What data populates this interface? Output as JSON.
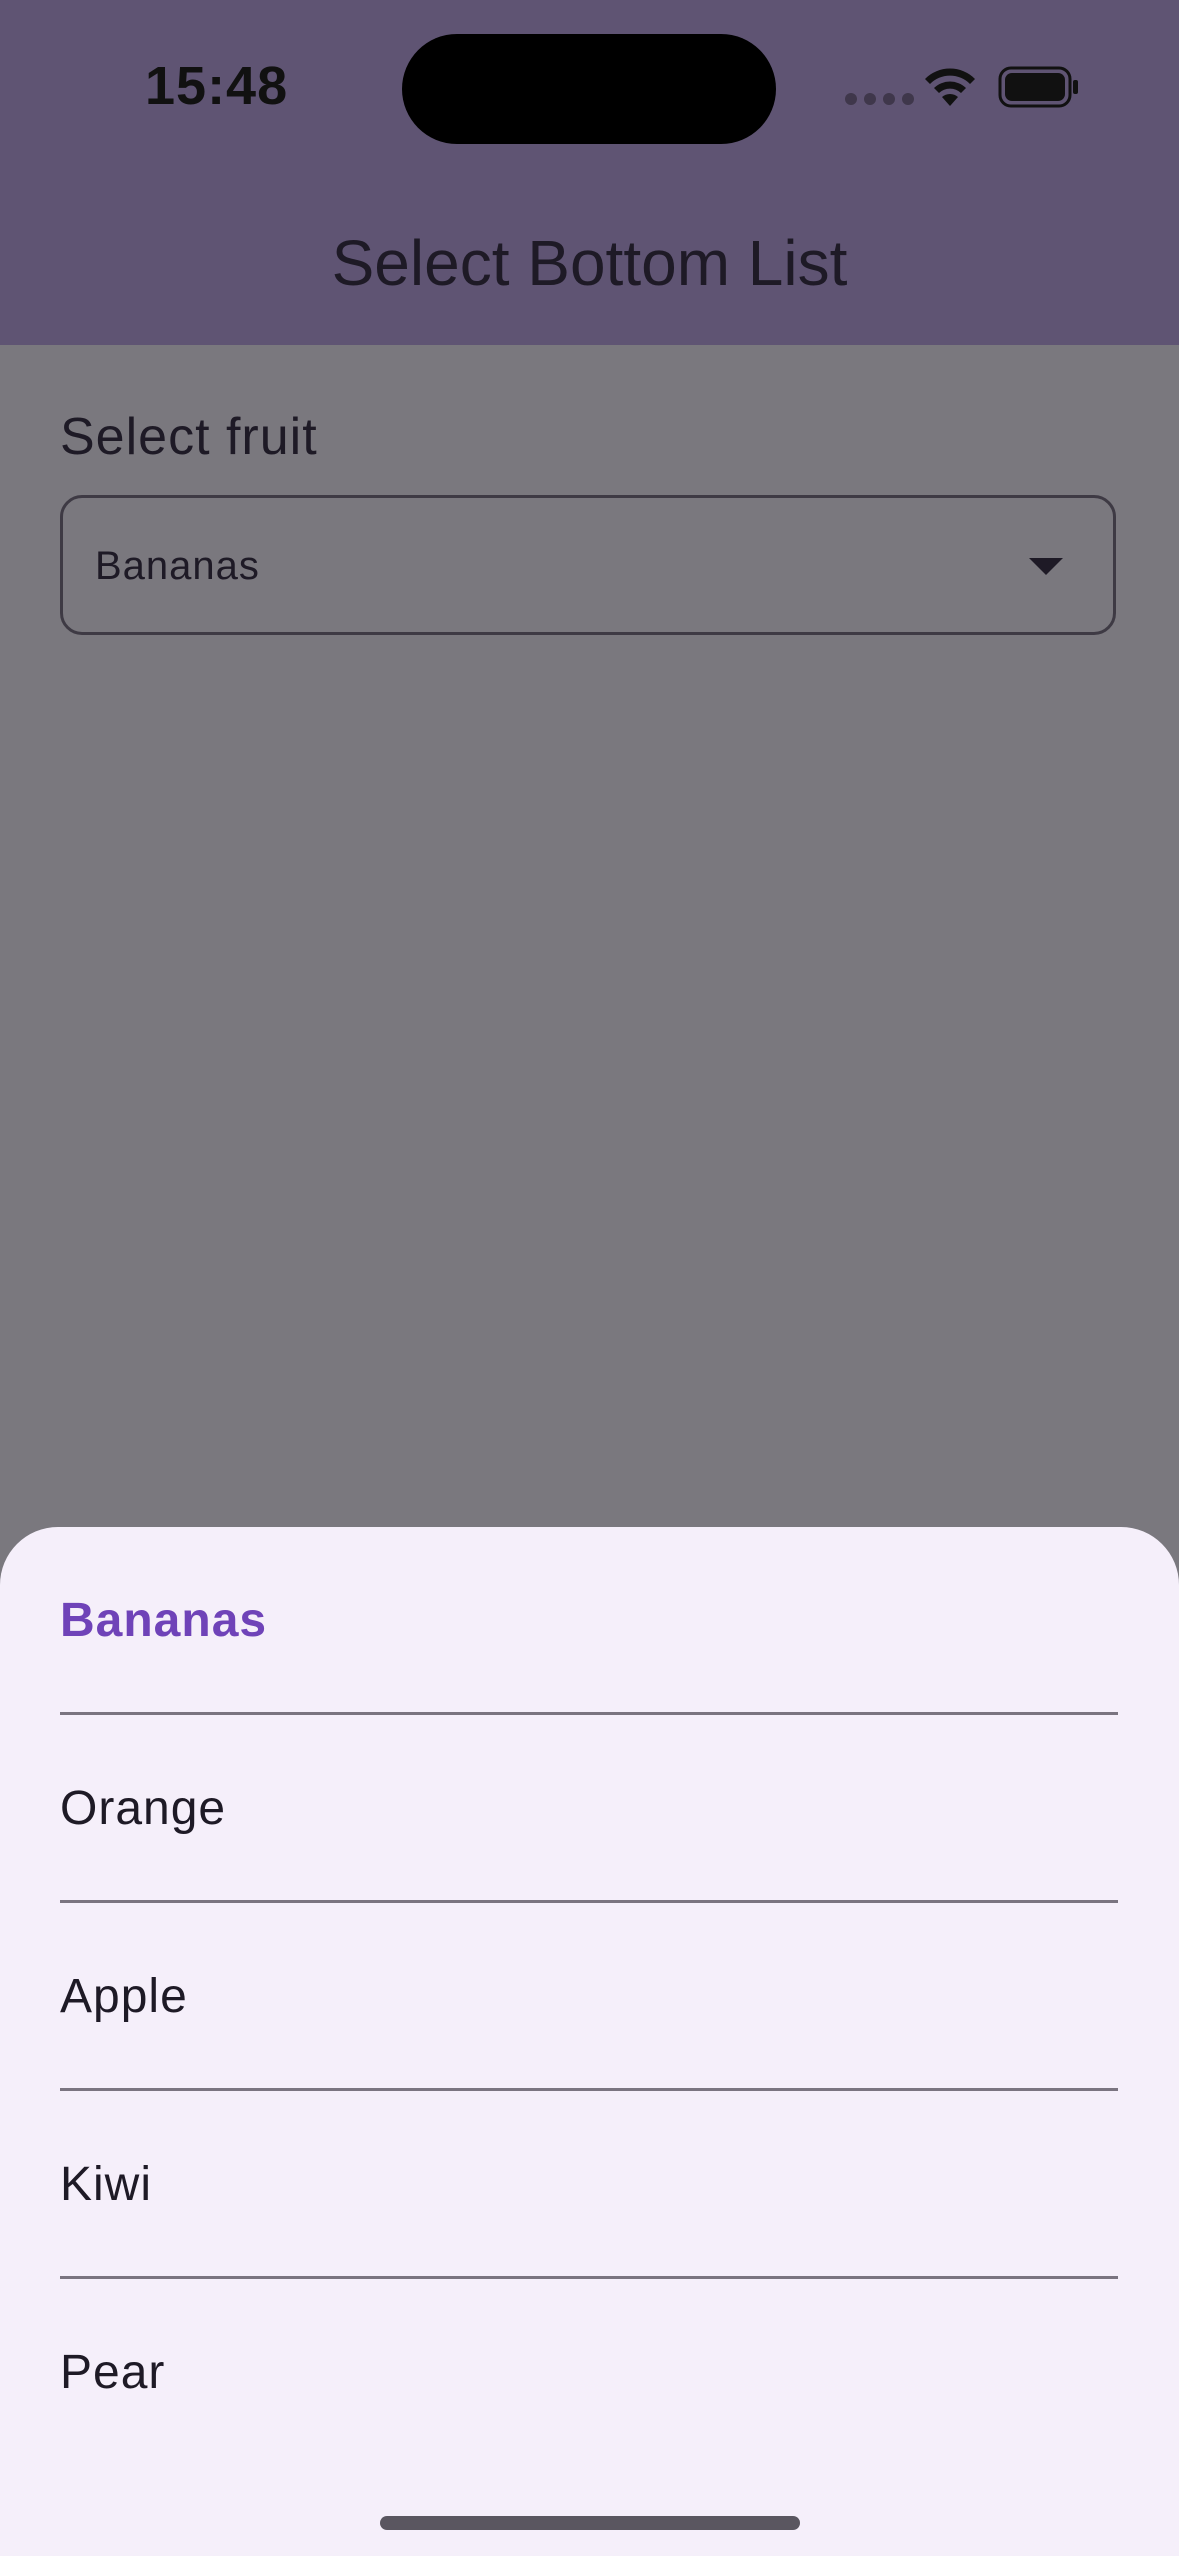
{
  "status_bar": {
    "time": "15:48",
    "wifi_icon": "wifi-icon",
    "battery_icon": "battery-icon"
  },
  "app_bar": {
    "title": "Select Bottom List"
  },
  "form": {
    "label": "Select fruit",
    "selected_value": "Bananas",
    "dropdown_icon": "chevron-down-icon"
  },
  "sheet": {
    "selected_index": 0,
    "items": [
      {
        "label": "Bananas"
      },
      {
        "label": "Orange"
      },
      {
        "label": "Apple"
      },
      {
        "label": "Kiwi"
      },
      {
        "label": "Pear"
      }
    ]
  },
  "colors": {
    "app_bar": "#5f5473",
    "scrim": "#7a787e",
    "sheet_bg": "#f5effa",
    "selected_text": "#6f43b8",
    "text": "#1e1a26"
  }
}
